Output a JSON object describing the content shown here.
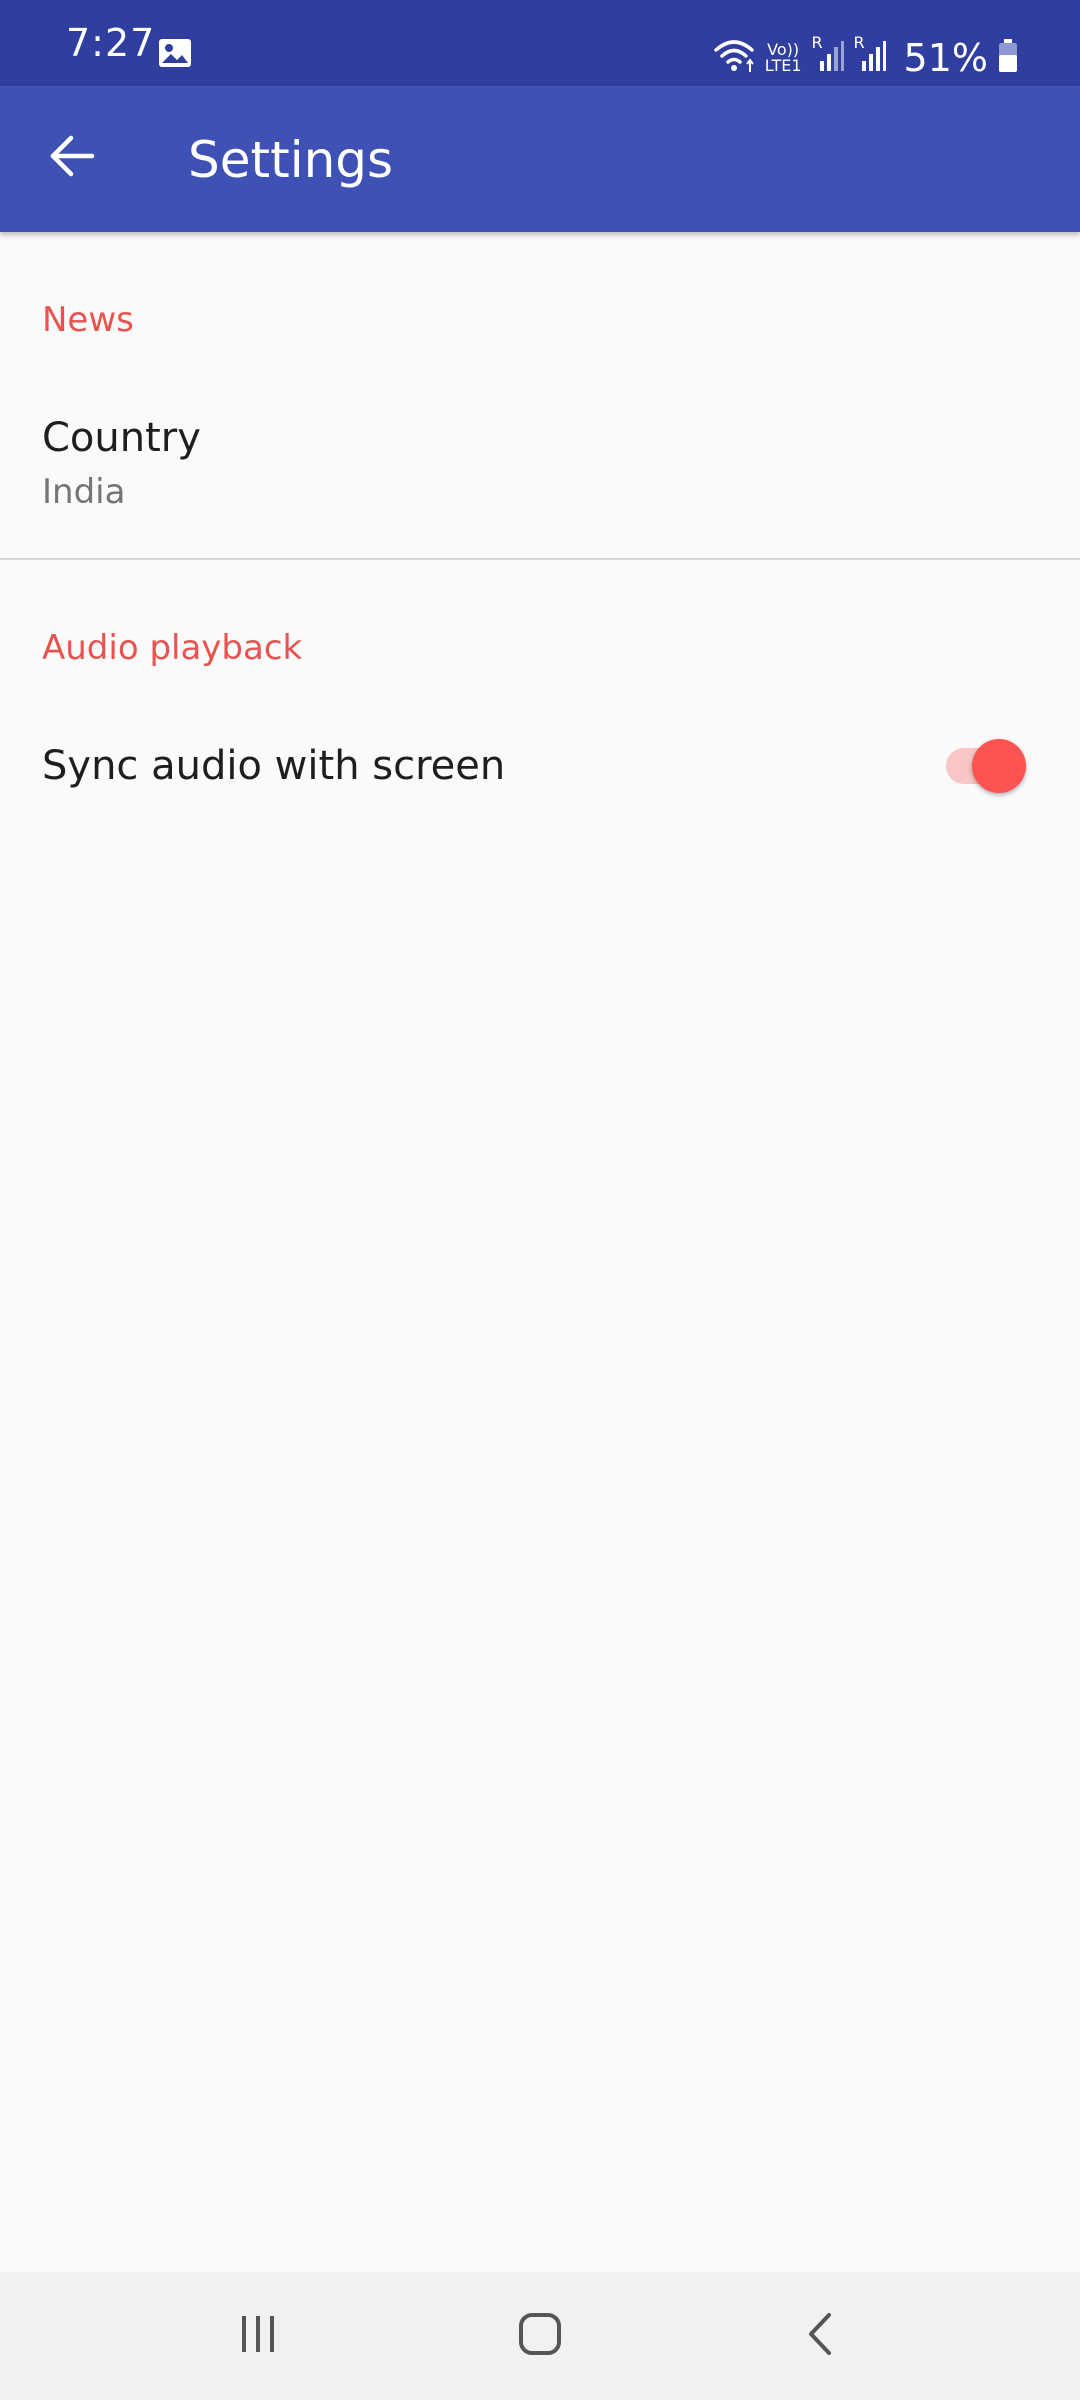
{
  "status_bar": {
    "time": "7:27",
    "network_vo": "Vo))",
    "network_lte": "LTE1",
    "roaming_1": "R",
    "roaming_2": "R",
    "battery": "51%",
    "icons": [
      "gallery-icon",
      "wifi-icon",
      "volte-icon",
      "signal-icon",
      "battery-icon"
    ]
  },
  "app_bar": {
    "title": "Settings",
    "back_icon": "arrow-left-icon",
    "background": "#3f51b5"
  },
  "sections": [
    {
      "category": "News",
      "preferences": [
        {
          "title": "Country",
          "summary": "India"
        }
      ]
    },
    {
      "category": "Audio playback",
      "preferences": [
        {
          "title": "Sync audio with screen",
          "switch_on": true
        }
      ]
    }
  ],
  "nav_bar": {
    "icons": [
      "recent-apps-icon",
      "home-icon",
      "back-icon"
    ]
  },
  "colors": {
    "status_bar": "#303f9f",
    "app_bar": "#3f51b5",
    "accent": "#ff5252",
    "category_text": "#e8534f",
    "background": "#fafafa"
  }
}
